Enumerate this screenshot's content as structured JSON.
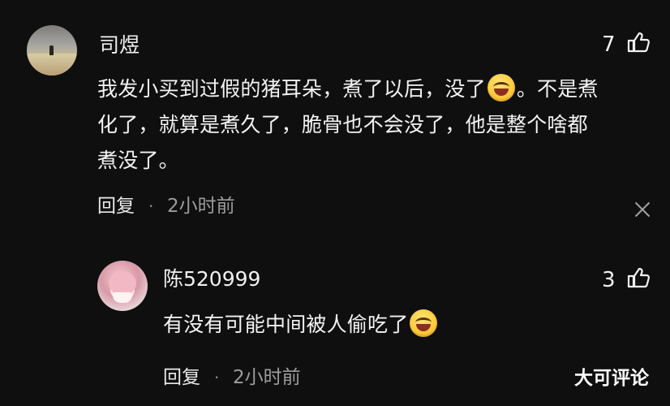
{
  "comment": {
    "username": "司煜",
    "likes": "7",
    "lines": [
      {
        "before": "我发小买到过假的猪耳朵，煮了以后，没了",
        "emoji": "laughing-crying-emoji",
        "after": "。不是煮"
      },
      {
        "text": "化了，就算是煮久了，脆骨也不会没了，他是整个啥都"
      },
      {
        "text": "煮没了。"
      }
    ],
    "reply_label": "回复",
    "time": "2小时前"
  },
  "reply": {
    "username": "陈520999",
    "likes": "3",
    "text": "有没有可能中间被人偷吃了",
    "emoji": "laughing-crying-emoji",
    "reply_label": "回复",
    "time": "2小时前"
  },
  "watermark": "大可评论",
  "icons": {
    "like": "thumb-up-icon",
    "close": "close-icon"
  }
}
